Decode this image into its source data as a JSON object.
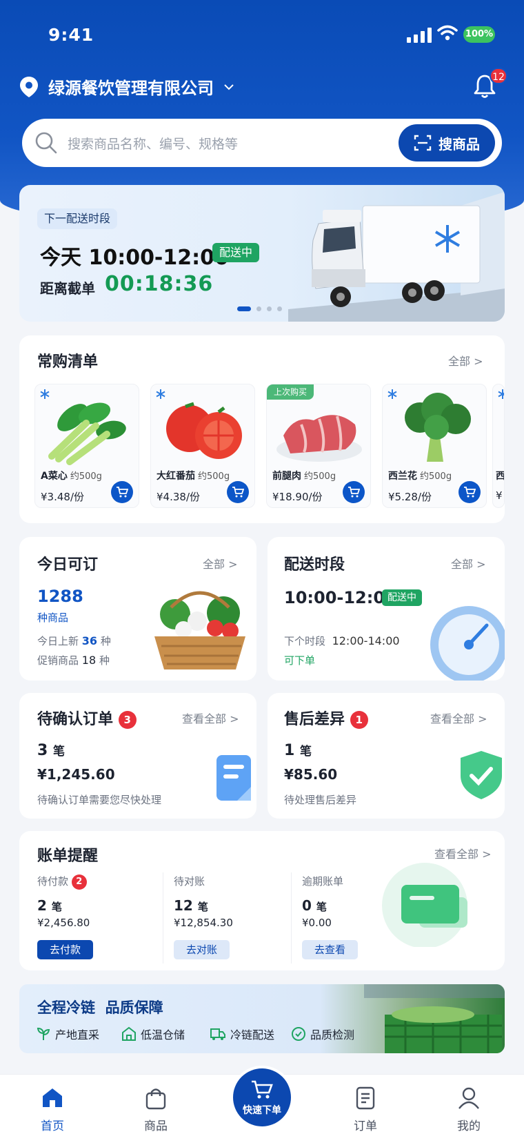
{
  "status_bar": {
    "time": "9:41",
    "battery": "100%"
  },
  "header": {
    "company": "绿源餐饮管理有限公司",
    "notification_count": "12"
  },
  "search": {
    "placeholder": "搜索商品名称、编号、规格等",
    "button_label": "搜商品"
  },
  "banner": {
    "tag": "下一配送时段",
    "time_range": "今天 10:00-12:00",
    "status": "配送中",
    "cutoff_label": "距离截单",
    "countdown": "00:18:36",
    "slides": 4,
    "active_slide": 1
  },
  "frequent": {
    "title": "常购清单",
    "more": "全部 >",
    "items": [
      {
        "name": "A菜心",
        "spec": "约500g",
        "price": "¥3.48/份",
        "frozen": true,
        "tag": ""
      },
      {
        "name": "大红番茄",
        "spec": "约500g",
        "price": "¥4.38/份",
        "frozen": true,
        "tag": ""
      },
      {
        "name": "前腿肉",
        "spec": "约500g",
        "price": "¥18.90/份",
        "frozen": false,
        "tag": "上次购买"
      },
      {
        "name": "西兰花",
        "spec": "约500g",
        "price": "¥5.28/份",
        "frozen": true,
        "tag": ""
      }
    ],
    "partial_item": {
      "name": "西",
      "price": "¥"
    }
  },
  "today": {
    "title": "今日可订",
    "more": "全部 >",
    "count": "1288",
    "unit": "种商品",
    "new_label": "今日上新",
    "new_count": "36",
    "new_unit": "种",
    "promo_label": "促销商品",
    "promo_count": "18",
    "promo_unit": "种"
  },
  "delivery": {
    "title": "配送时段",
    "more": "全部 >",
    "time_range": "10:00-12:00",
    "status": "配送中",
    "next_label": "下个时段",
    "next_range": "12:00-14:00",
    "next_status": "可下单"
  },
  "pending": {
    "title": "待确认订单",
    "badge": "3",
    "more": "查看全部 >",
    "count": "3",
    "unit": "笔",
    "amount": "¥1,245.60",
    "desc": "待确认订单需要您尽快处理"
  },
  "aftersale": {
    "title": "售后差异",
    "badge": "1",
    "more": "查看全部 >",
    "count": "1",
    "unit": "笔",
    "amount": "¥85.60",
    "desc": "待处理售后差异"
  },
  "bills": {
    "title": "账单提醒",
    "more": "查看全部 >",
    "columns": [
      {
        "label": "待付款",
        "badge": "2",
        "count": "2",
        "unit": "笔",
        "amount": "¥2,456.80",
        "button": "去付款"
      },
      {
        "label": "待对账",
        "badge": "",
        "count": "12",
        "unit": "笔",
        "amount": "¥12,854.30",
        "button": "去对账"
      },
      {
        "label": "逾期账单",
        "badge": "",
        "count": "0",
        "unit": "笔",
        "amount": "¥0.00",
        "button": "去查看"
      }
    ]
  },
  "coldchain": {
    "title": "全程冷链  品质保障",
    "features": [
      "产地直采",
      "低温仓储",
      "冷链配送",
      "品质检测"
    ]
  },
  "tabbar": {
    "home": "首页",
    "goods": "商品",
    "quick": "快速下单",
    "orders": "订单",
    "mine": "我的"
  },
  "colors": {
    "primary": "#0c48b0",
    "green": "#1fa462",
    "red": "#e8313b"
  }
}
